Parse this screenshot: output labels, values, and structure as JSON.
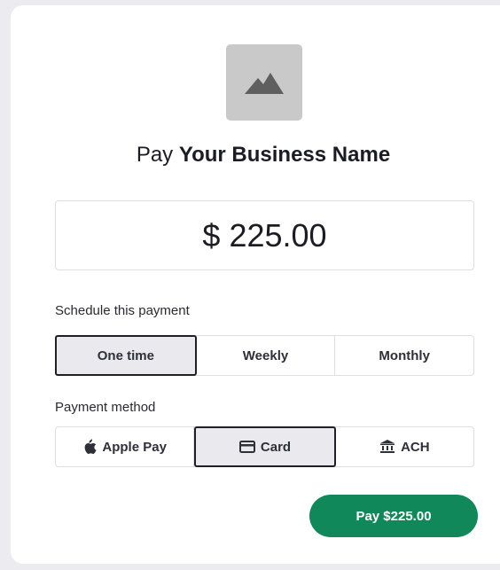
{
  "payment": {
    "pay_prefix": "Pay",
    "business_name": "Your Business Name",
    "amount": "$ 225.00"
  },
  "schedule": {
    "label": "Schedule this payment",
    "options": [
      "One time",
      "Weekly",
      "Monthly"
    ],
    "selected": "One time"
  },
  "method": {
    "label": "Payment method",
    "options": [
      {
        "label": "Apple Pay",
        "icon": "apple-icon"
      },
      {
        "label": "Card",
        "icon": "credit-card-icon"
      },
      {
        "label": "ACH",
        "icon": "bank-icon"
      }
    ],
    "selected": "Card"
  },
  "submit": {
    "label": "Pay $225.00"
  },
  "colors": {
    "accent": "#11885a",
    "selected_bg": "#e9e9ee",
    "logo_placeholder": "#c9c9c9"
  }
}
